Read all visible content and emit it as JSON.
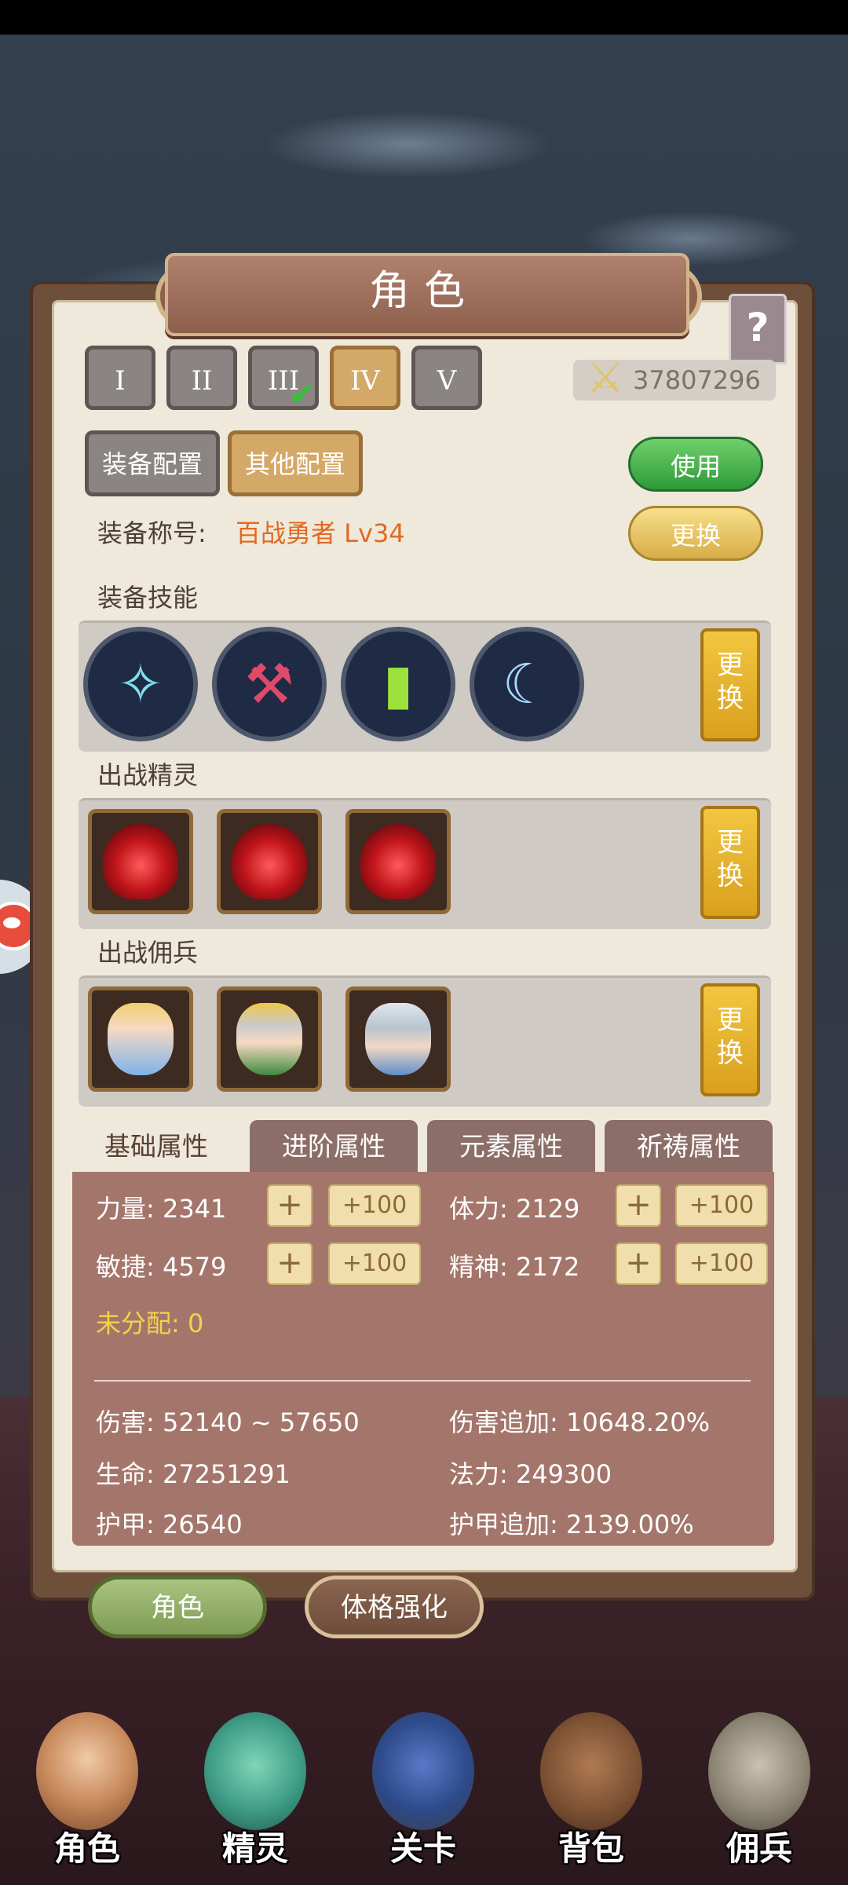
{
  "window": {
    "title": "角色",
    "help_label": "?"
  },
  "loadouts": {
    "tabs": [
      "I",
      "II",
      "III",
      "IV",
      "V"
    ],
    "active_index": 3,
    "checked_index": 2
  },
  "power": {
    "value": "37807296"
  },
  "config": {
    "equip_label": "装备配置",
    "other_label": "其他配置",
    "use_label": "使用",
    "swap_label": "更换"
  },
  "equipment": {
    "title_label": "装备称号:",
    "title_value": "百战勇者 Lv34",
    "skills_label": "装备技能",
    "spirits_label": "出战精灵",
    "mercs_label": "出战佣兵",
    "change_label_top": "更",
    "change_label_bottom": "换"
  },
  "skills": [
    {
      "icon": "ice-slash-skill-icon",
      "color": "#7fe0f0"
    },
    {
      "icon": "hammer-strike-skill-icon",
      "color": "#e04a6a"
    },
    {
      "icon": "green-pillar-skill-icon",
      "color": "#9de23a"
    },
    {
      "icon": "crescent-wave-skill-icon",
      "color": "#a8d8ff"
    }
  ],
  "attributes": {
    "tabs": [
      "基础属性",
      "进阶属性",
      "元素属性",
      "祈祷属性"
    ],
    "active_tab": 0,
    "strength": "力量: 2341",
    "stamina": "体力: 2129",
    "agility": "敏捷: 4579",
    "spirit": "精神: 2172",
    "unassigned": "未分配: 0",
    "plus": "+",
    "plus100": "+100",
    "damage": "伤害: 52140 ~ 57650",
    "damage_bonus": "伤害追加: 10648.20%",
    "life": "生命: 27251291",
    "mana": "法力: 249300",
    "armor": "护甲: 26540",
    "armor_bonus": "护甲追加: 2139.00%"
  },
  "bottom_tabs": {
    "role": "角色",
    "body": "体格强化"
  },
  "nav": [
    "角色",
    "精灵",
    "关卡",
    "背包",
    "佣兵"
  ],
  "colors": {
    "accent_gold": "#d4a867",
    "use_green": "#2f9a3a",
    "title_orange": "#e06a20",
    "unassigned_yellow": "#f3d24a"
  }
}
